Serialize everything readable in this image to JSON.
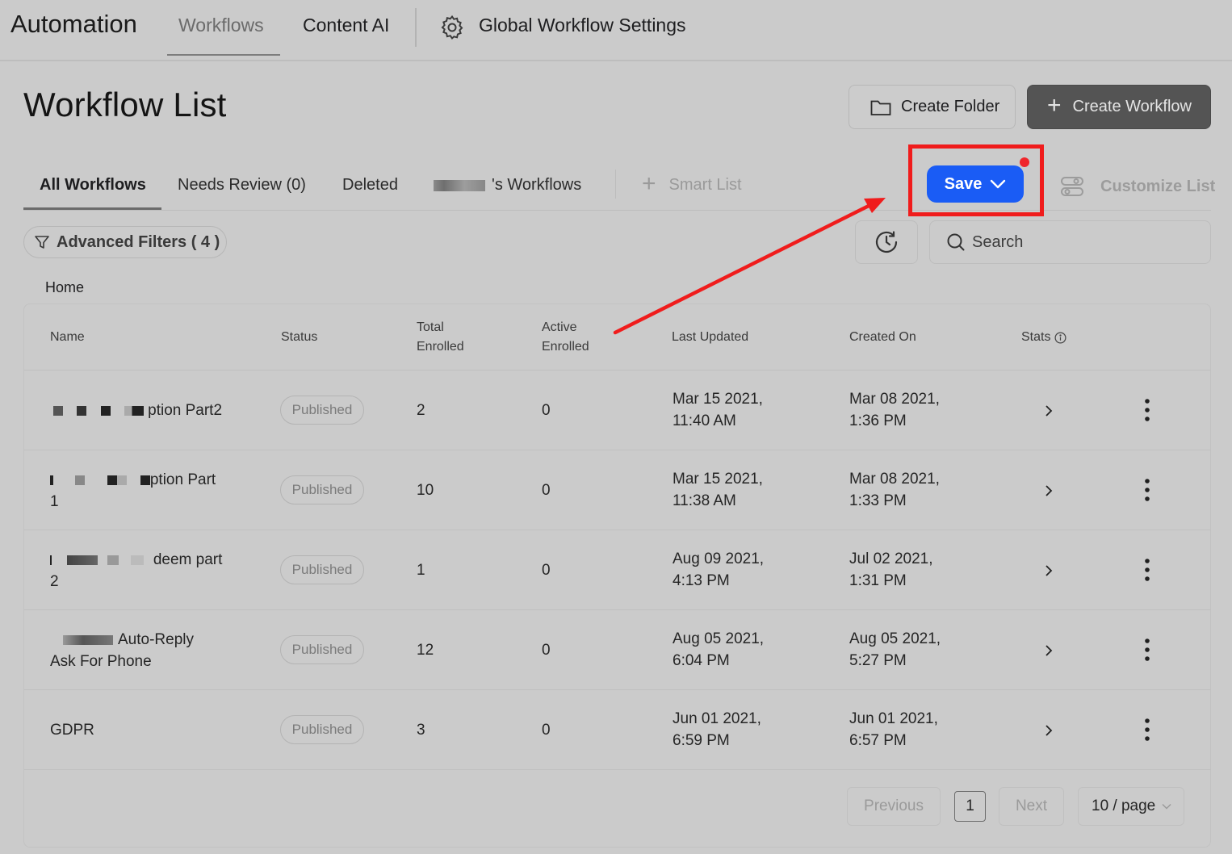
{
  "nav": {
    "app_title": "Automation",
    "tabs": [
      {
        "label": "Workflows",
        "active": true
      },
      {
        "label": "Content AI",
        "active": false
      },
      {
        "label": "Global Workflow Settings",
        "icon": "gear-icon"
      }
    ]
  },
  "header": {
    "title": "Workflow List",
    "create_folder_label": "Create Folder",
    "create_workflow_label": "Create Workflow"
  },
  "list_tabs": {
    "all": "All Workflows",
    "needs_review": "Needs Review (0)",
    "deleted": "Deleted",
    "user_workflows": "'s Workflows",
    "smart_list": "Smart List",
    "save": "Save",
    "customize": "Customize List"
  },
  "filters": {
    "advanced_label": "Advanced Filters ( 4 )",
    "search_placeholder": "Search",
    "breadcrumb": "Home"
  },
  "table": {
    "columns": {
      "name": "Name",
      "status": "Status",
      "total_enrolled_1": "Total",
      "total_enrolled_2": "Enrolled",
      "active_enrolled_1": "Active",
      "active_enrolled_2": "Enrolled",
      "last_updated": "Last Updated",
      "created_on": "Created On",
      "stats": "Stats"
    },
    "rows": [
      {
        "name_1": "ption Part2",
        "name_2": "",
        "status": "Published",
        "total": "2",
        "active": "0",
        "updated_1": "Mar 15 2021,",
        "updated_2": "11:40 AM",
        "created_1": "Mar 08 2021,",
        "created_2": "1:36 PM"
      },
      {
        "name_1": "ption Part",
        "name_2": "1",
        "status": "Published",
        "total": "10",
        "active": "0",
        "updated_1": "Mar 15 2021,",
        "updated_2": "11:38 AM",
        "created_1": "Mar 08 2021,",
        "created_2": "1:33 PM"
      },
      {
        "name_1": "deem part",
        "name_2": "2",
        "status": "Published",
        "total": "1",
        "active": "0",
        "updated_1": "Aug 09 2021,",
        "updated_2": "4:13 PM",
        "created_1": "Jul 02 2021,",
        "created_2": "1:31 PM"
      },
      {
        "name_1": "Auto-Reply",
        "name_2": "Ask For Phone",
        "status": "Published",
        "total": "12",
        "active": "0",
        "updated_1": "Aug 05 2021,",
        "updated_2": "6:04 PM",
        "created_1": "Aug 05 2021,",
        "created_2": "5:27 PM"
      },
      {
        "name_1": "GDPR",
        "name_2": "",
        "status": "Published",
        "total": "3",
        "active": "0",
        "updated_1": "Jun 01 2021,",
        "updated_2": "6:59 PM",
        "created_1": "Jun 01 2021,",
        "created_2": "6:57 PM"
      }
    ]
  },
  "pagination": {
    "previous": "Previous",
    "page": "1",
    "next": "Next",
    "page_size": "10 / page"
  },
  "colors": {
    "save_blue": "#1a5cf5",
    "highlight_red": "#f01c1c",
    "create_button": "#545454"
  }
}
